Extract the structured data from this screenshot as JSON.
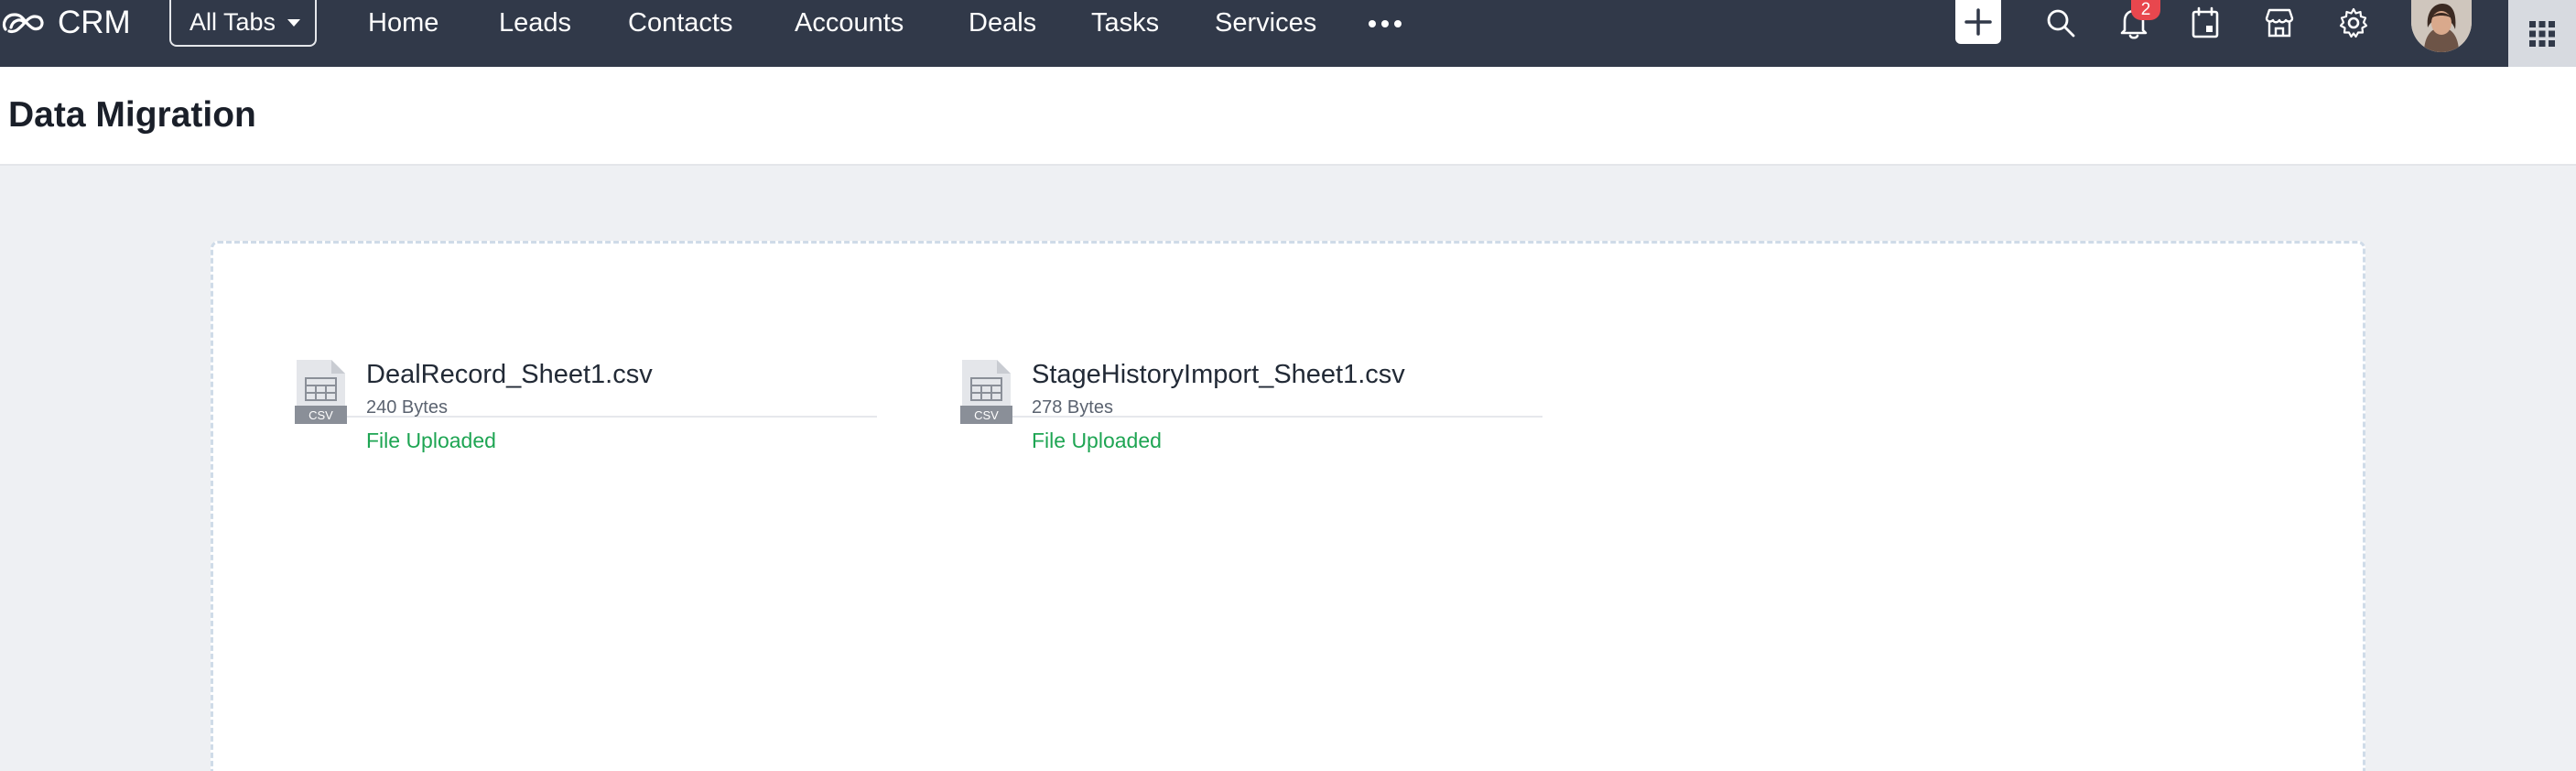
{
  "nav": {
    "brand": "CRM",
    "all_tabs_label": "All Tabs",
    "tabs": [
      {
        "label": "Home"
      },
      {
        "label": "Leads"
      },
      {
        "label": "Contacts"
      },
      {
        "label": "Accounts"
      },
      {
        "label": "Deals"
      },
      {
        "label": "Tasks"
      },
      {
        "label": "Services"
      }
    ],
    "more_icon": "more-horizontal-icon",
    "notification_count": "2",
    "icons": [
      "plus-icon",
      "search-icon",
      "bell-icon",
      "calendar-icon",
      "marketplace-icon",
      "gear-icon",
      "avatar",
      "app-grid-icon"
    ]
  },
  "page": {
    "title": "Data Migration"
  },
  "files": [
    {
      "name": "DealRecord_Sheet1.csv",
      "size": "240 Bytes",
      "status": "File Uploaded",
      "icon_label": "CSV"
    },
    {
      "name": "StageHistoryImport_Sheet1.csv",
      "size": "278 Bytes",
      "status": "File Uploaded",
      "icon_label": "CSV"
    }
  ],
  "colors": {
    "topbar": "#313949",
    "status_success": "#1ea553",
    "badge": "#e8474e",
    "page_background": "#eef0f3"
  }
}
